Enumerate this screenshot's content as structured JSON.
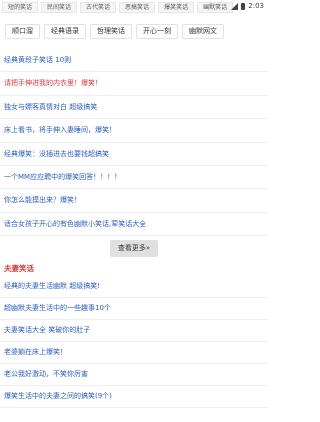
{
  "top_tabs": [
    "短的笑话",
    "民间笑话",
    "古代笑话",
    "恶搞笑话",
    "爆笑笑话",
    "幽默笑话"
  ],
  "status": {
    "time": "2:03"
  },
  "tags": [
    "顺口溜",
    "经典语录",
    "哲理笑话",
    "开心一刻",
    "幽默网文"
  ],
  "list_a": [
    "经典黄段子笑话 10则",
    "请把手伸进我的内衣里！爆笑！",
    "独女与嫖客真情对白 超级搞笑",
    "床上看书，将手伸入妻睡间，爆笑！",
    "经典爆笑：没插进去也要钱超搞笑",
    "一个MM应应聘中的爆笑回答！！！！",
    "你怎么能摸出来？爆笑！",
    "适合女孩子开心的有色幽默小笑话,荤笑话大全"
  ],
  "more_button": "查看更多»",
  "section_title": "夫妻笑话",
  "list_b": [
    "经典的夫妻生活幽默 超级搞笑!",
    "超幽默夫妻生活中的一些趣事10个",
    "夫妻笑话大全 笑破你的肚子",
    "老婆躺在床上爆笑！",
    "老公我好激动，不笑你厉害",
    "爆笑生活中的夫妻之间的搞笑(9个)"
  ],
  "colors": {
    "link": "#2a5eb8",
    "highlight": "#d83a3a"
  }
}
